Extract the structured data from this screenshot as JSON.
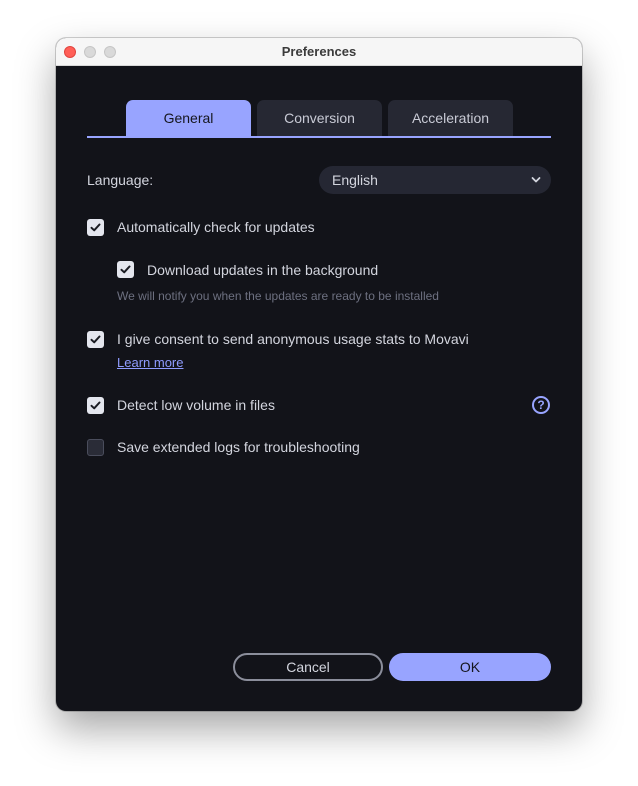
{
  "window": {
    "title": "Preferences"
  },
  "tabs": [
    {
      "label": "General",
      "active": true
    },
    {
      "label": "Conversion",
      "active": false
    },
    {
      "label": "Acceleration",
      "active": false
    }
  ],
  "language": {
    "label": "Language:",
    "value": "English"
  },
  "options": {
    "auto_update": {
      "label": "Automatically check for updates",
      "checked": true
    },
    "background_download": {
      "label": "Download updates in the background",
      "checked": true,
      "hint": "We will notify you when the updates are ready to be installed"
    },
    "usage_stats": {
      "label": "I give consent to send anonymous usage stats to Movavi",
      "checked": true,
      "link": "Learn more"
    },
    "low_volume": {
      "label": "Detect low volume in files",
      "checked": true
    },
    "extended_logs": {
      "label": "Save extended logs for troubleshooting",
      "checked": false
    }
  },
  "buttons": {
    "cancel": "Cancel",
    "ok": "OK"
  },
  "colors": {
    "accent": "#98a4ff",
    "background": "#121319",
    "control": "#252733"
  },
  "icons": {
    "help": "question-circle-icon",
    "chevron": "chevron-down-icon",
    "check": "checkmark-icon"
  }
}
